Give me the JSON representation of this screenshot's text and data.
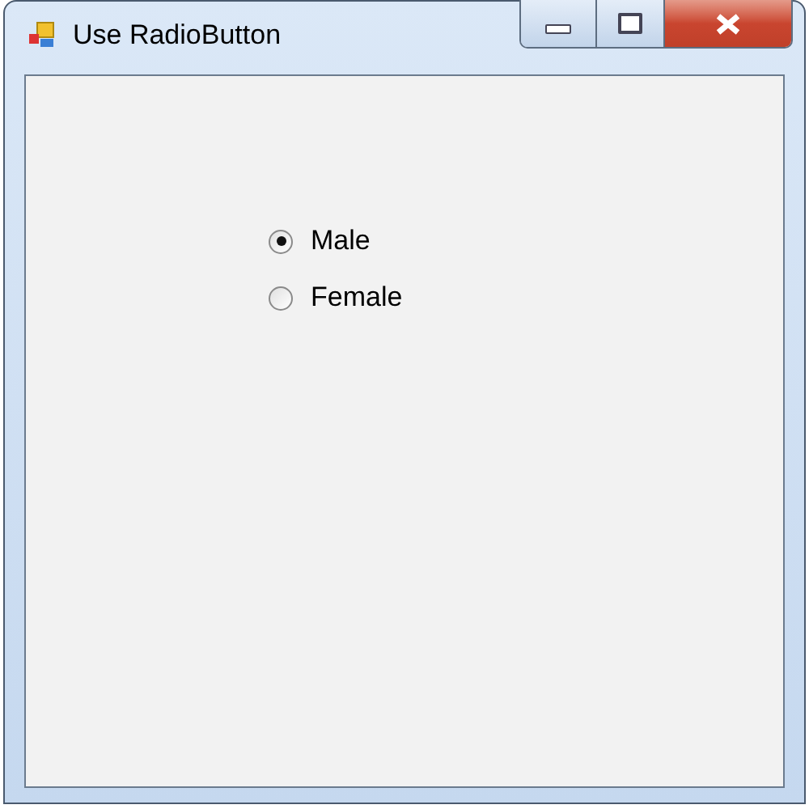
{
  "window": {
    "title": "Use RadioButton"
  },
  "radios": [
    {
      "label": "Male",
      "selected": true
    },
    {
      "label": "Female",
      "selected": false
    }
  ]
}
